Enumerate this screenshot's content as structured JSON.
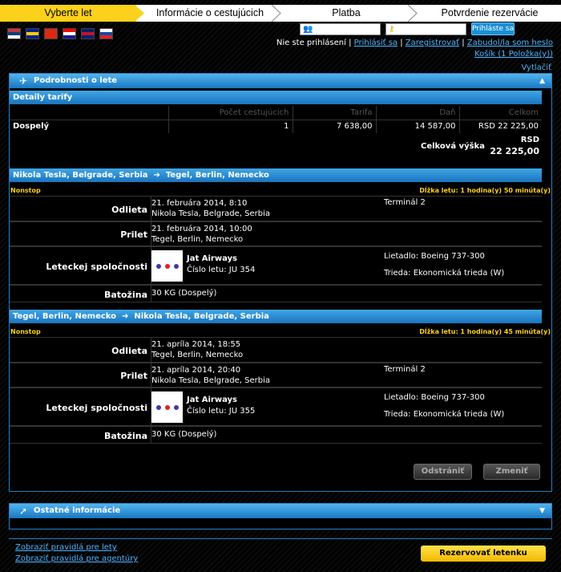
{
  "steps": [
    "Vyberte let",
    "Informácie o cestujúcich",
    "Platba",
    "Potvrdenie rezervácie"
  ],
  "flags": [
    {
      "name": "serbia-flag",
      "colors": [
        "#c6363c",
        "#0c4076",
        "#ffffff"
      ]
    },
    {
      "name": "bosnia-flag",
      "colors": [
        "#002395",
        "#fecb00",
        "#002395"
      ]
    },
    {
      "name": "china-flag",
      "colors": [
        "#de2910",
        "#de2910",
        "#de2910"
      ]
    },
    {
      "name": "croatia-flag",
      "colors": [
        "#ff0000",
        "#ffffff",
        "#171796"
      ]
    },
    {
      "name": "uk-flag",
      "colors": [
        "#012169",
        "#c8102e",
        "#012169"
      ]
    },
    {
      "name": "slovakia-flag",
      "colors": [
        "#ffffff",
        "#0b4ea2",
        "#ee1c25"
      ]
    }
  ],
  "login": {
    "button": "Prihláste sa",
    "status": "Nie ste prihlásení",
    "login_link": "Prihlásiť sa",
    "register_link": "Zaregistrovať",
    "forgot_link": "Zabudol/la som heslo",
    "cart": "Košík (1 Položka(y))",
    "print": "Vytlačiť"
  },
  "flight_panel": {
    "title": "Podrobnosti o lete",
    "toggle_icon": "collapse-up-icon"
  },
  "fare": {
    "title": "Detaily tarify",
    "headers": [
      "",
      "Počet cestujúcich",
      "Tarifa",
      "Daň",
      "Celkom"
    ],
    "rows": [
      [
        "Dospelý",
        "1",
        "7 638,00",
        "14 587,00",
        "RSD 22 225,00"
      ]
    ],
    "total_label": "Celková výška",
    "total_currency": "RSD",
    "total_value": "22 225,00"
  },
  "segments": [
    {
      "from": "Nikola Tesla, Belgrade, Serbia",
      "to": "Tegel, Berlin, Nemecko",
      "nonstop": "Nonstop",
      "duration": "Dĺžka letu: 1 hodina(y) 50 minúta(y)",
      "dep_label": "Odlieta",
      "dep_date": "21. februára 2014, 8:10",
      "dep_place": "Nikola Tesla, Belgrade, Serbia",
      "dep_terminal": "Terminál 2",
      "arr_label": "Prilet",
      "arr_date": "21. februára 2014, 10:00",
      "arr_place": "Tegel, Berlin, Nemecko",
      "arr_terminal": "",
      "airline_label": "Leteckej spoločnosti",
      "airline": "Jat Airways",
      "flight_no": "Číslo letu: JU 354",
      "aircraft": "Lietadlo: Boeing 737-300",
      "cabin": "Trieda: Ekonomická trieda (W)",
      "bag_label": "Batožina",
      "bag": "30 KG (Dospelý)"
    },
    {
      "from": "Tegel, Berlin, Nemecko",
      "to": "Nikola Tesla, Belgrade, Serbia",
      "nonstop": "Nonstop",
      "duration": "Dĺžka letu: 1 hodina(y) 45 minúta(y)",
      "dep_label": "Odlieta",
      "dep_date": "21. apríla 2014, 18:55",
      "dep_place": "Tegel, Berlin, Nemecko",
      "dep_terminal": "",
      "arr_label": "Prilet",
      "arr_date": "21. apríla 2014, 20:40",
      "arr_place": "Nikola Tesla, Belgrade, Serbia",
      "arr_terminal": "Terminál 2",
      "airline_label": "Leteckej spoločnosti",
      "airline": "Jat Airways",
      "flight_no": "Číslo letu: JU 355",
      "aircraft": "Lietadlo: Boeing 737-300",
      "cabin": "Trieda: Ekonomická trieda (W)",
      "bag_label": "Batožina",
      "bag": "30 KG (Dospelý)"
    }
  ],
  "actions": {
    "remove": "Odstrániť",
    "change": "Zmeniť"
  },
  "other_panel": {
    "title": "Ostatné informácie",
    "toggle_icon": "expand-down-icon"
  },
  "footer": {
    "rules_flights": "Zobraziť pravidlá pre lety",
    "rules_agency": "Zobraziť pravidlá pre agentúry",
    "book": "Rezervovať letenku"
  },
  "colors": {
    "accent": "#fcd11b",
    "panel_blue": "#1877c2",
    "link": "#4db5ff"
  }
}
